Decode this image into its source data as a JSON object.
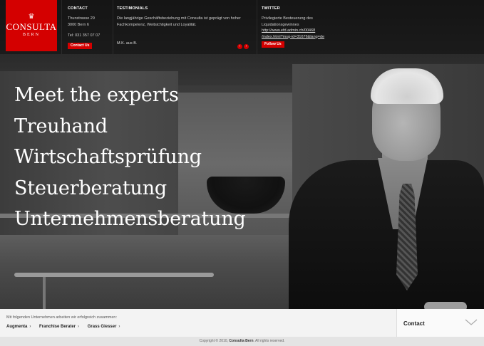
{
  "brand": {
    "name": "CONSULTA",
    "city": "BERN"
  },
  "contact": {
    "heading": "CONTACT",
    "street": "Thunstrasse 29",
    "zip_city": "3000 Bern 6",
    "phone": "Tel: 031 357 07 07",
    "button": "Contact Us"
  },
  "testimonials": {
    "heading": "TESTIMONIALS",
    "text": "Die langjährige Geschäftsbeziehung mit Consulta ist geprägt von hoher Fachkompetenz, Weitsichtigkeit und Loyalität.",
    "author": "M.K. aus B.",
    "prev": "‹",
    "next": "›"
  },
  "twitter": {
    "heading": "TWITTER",
    "text": "Privilegierte Besteuerung des Liquidationsgewinnes",
    "link_line1": "http://www.efd.admin.ch/00468",
    "link_line2": "/index.html?msg-id=31676&lang=de",
    "button": "Follow Us"
  },
  "headlines": [
    "Meet the experts",
    "Treuhand",
    "Wirtschaftsprüfung",
    "Steuerberatung",
    "Unternehmensberatung"
  ],
  "partners": {
    "intro": "Mit folgenden Unternehmen arbeiten wir erfolgreich zusammen:",
    "items": [
      {
        "label": "Augmenta",
        "chev": "›"
      },
      {
        "label": "Franchise Berater",
        "chev": "›"
      },
      {
        "label": "Grass Giesser",
        "chev": "›"
      }
    ]
  },
  "contact_panel": {
    "label": "Contact"
  },
  "footer": {
    "prefix": "Copyright © 2010,",
    "company": "Consulta Bern",
    "suffix": ". All rights reserved."
  },
  "colors": {
    "accent": "#d40000",
    "footer_bg": "#f3f3f3"
  }
}
